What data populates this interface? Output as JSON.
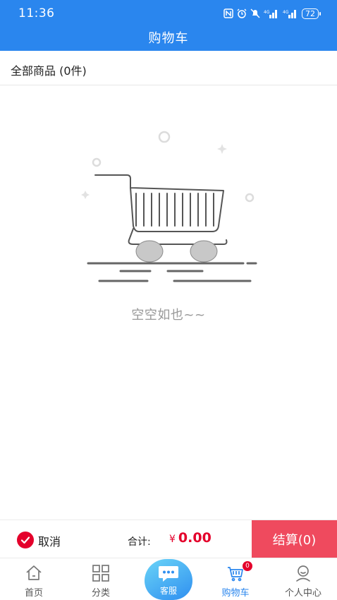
{
  "status_bar": {
    "time": "11:36",
    "battery": "72"
  },
  "header": {
    "title": "购物车"
  },
  "goods": {
    "all_label": "全部商品 (0件)"
  },
  "empty_state": {
    "message": "空空如也~~"
  },
  "checkout_bar": {
    "cancel_label": "取消",
    "total_label": "合计:",
    "currency": "¥",
    "total_amount": "0.00",
    "checkout_label": "结算(0)"
  },
  "bottom_nav": {
    "items": [
      {
        "label": "首页",
        "icon": "home-icon"
      },
      {
        "label": "分类",
        "icon": "grid-icon"
      },
      {
        "label": "客服",
        "icon": "chat-icon"
      },
      {
        "label": "购物车",
        "icon": "cart-icon",
        "badge": "0",
        "active": true
      },
      {
        "label": "个人中心",
        "icon": "user-icon"
      }
    ]
  },
  "colors": {
    "primary": "#2a86ee",
    "accent_red": "#e4002b",
    "checkout_button": "#ef4a5e",
    "muted_text": "#999999"
  }
}
